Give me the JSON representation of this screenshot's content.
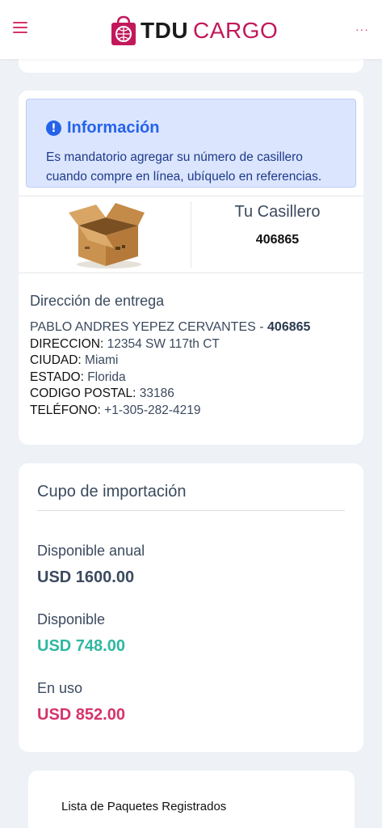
{
  "header": {
    "logo_tdu": "TDU",
    "logo_cargo": "CARGO",
    "more": "···"
  },
  "info": {
    "title": "Información",
    "text": "Es mandatorio agregar su número de casillero cuando compre en línea, ubíquelo en referencias."
  },
  "locker": {
    "title": "Tu Casillero",
    "number": "406865"
  },
  "address": {
    "heading": "Dirección de entrega",
    "name": "PABLO ANDRES YEPEZ CERVANTES",
    "sep": " - ",
    "code": "406865",
    "lines": [
      {
        "label": "DIRECCION:",
        "value": " 12354 SW 117th CT"
      },
      {
        "label": "CIUDAD:",
        "value": " Miami"
      },
      {
        "label": "ESTADO:",
        "value": " Florida"
      },
      {
        "label": "CODIGO POSTAL:",
        "value": " 33186"
      },
      {
        "label": "TELÉFONO:",
        "value": " +1-305-282-4219"
      }
    ]
  },
  "cupo": {
    "title": "Cupo de importación",
    "items": [
      {
        "label": "Disponible anual",
        "value": "USD 1600.00",
        "color": "#3b4a5e"
      },
      {
        "label": "Disponible",
        "value": "USD 748.00",
        "color": "#2fb8a0"
      },
      {
        "label": "En uso",
        "value": "USD 852.00",
        "color": "#d6336c"
      }
    ]
  },
  "list": {
    "title": "Lista de Paquetes Registrados"
  }
}
